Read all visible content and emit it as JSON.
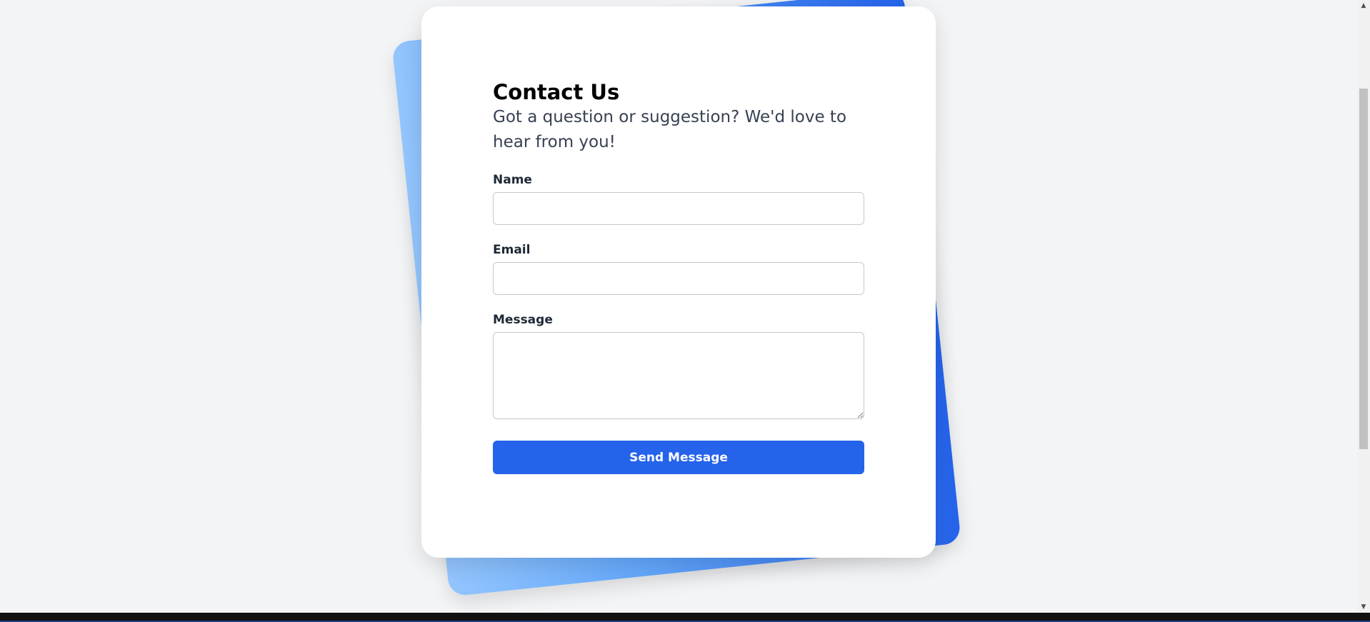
{
  "contact": {
    "title": "Contact Us",
    "subtitle": "Got a question or suggestion? We'd love to hear from you!",
    "name_label": "Name",
    "name_value": "",
    "email_label": "Email",
    "email_value": "",
    "message_label": "Message",
    "message_value": "",
    "submit_label": "Send Message"
  },
  "scrollbar": {
    "up_icon": "triangle-up",
    "down_icon": "triangle-down"
  },
  "colors": {
    "page_background": "#f3f4f6",
    "card_background": "#ffffff",
    "accent": "#2563eb",
    "gradient_start": "#93c5fd",
    "gradient_end": "#2563eb"
  }
}
